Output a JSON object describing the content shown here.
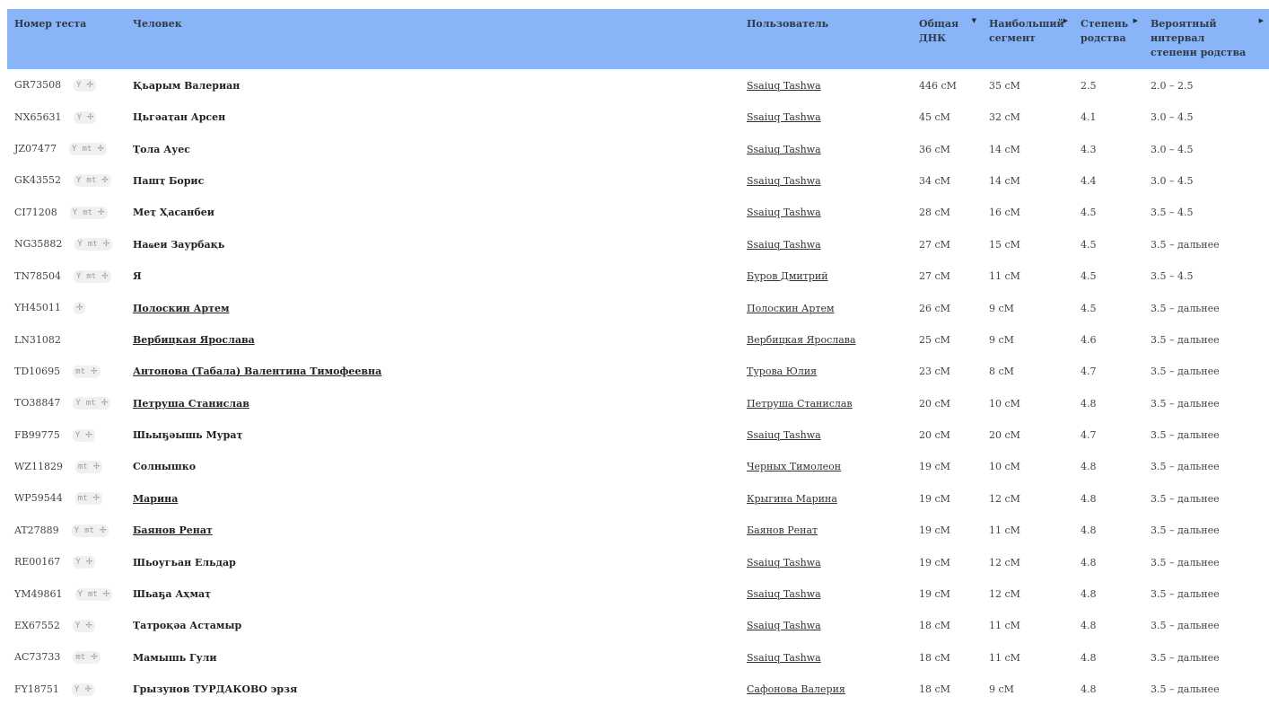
{
  "headers": {
    "test_number": "Номер теста",
    "person": "Человек",
    "user": "Пользователь",
    "total_dna_1": "Общая",
    "total_dna_2": "ДНК",
    "largest_1": "Наибольший",
    "largest_2": "сегмент",
    "degree_1": "Степень",
    "degree_2": "родства",
    "interval_1": "Вероятный интервал",
    "interval_2": "степени родства",
    "sort_down_icon": "▼",
    "sort_right_icon": "▶"
  },
  "rows": [
    {
      "id": "GR73508",
      "badges": [
        "Y",
        "🧬"
      ],
      "person": "Қьарым Валериан",
      "person_link": false,
      "user": "Ssaiuq Tashwa",
      "total": "446 cM",
      "largest": "35 cM",
      "degree": "2.5",
      "interval": "2.0 – 2.5"
    },
    {
      "id": "NX65631",
      "badges": [
        "Y",
        "🧬"
      ],
      "person": "Цьгәаҭан Арсен",
      "person_link": false,
      "user": "Ssaiuq Tashwa",
      "total": "45 cM",
      "largest": "32 cM",
      "degree": "4.1",
      "interval": "3.0 – 4.5"
    },
    {
      "id": "JZ07477",
      "badges": [
        "Y",
        "mt",
        "🧬"
      ],
      "person": "Ҭола Ауес",
      "person_link": false,
      "user": "Ssaiuq Tashwa",
      "total": "36 cM",
      "largest": "14 cM",
      "degree": "4.3",
      "interval": "3.0 – 4.5"
    },
    {
      "id": "GK43552",
      "badges": [
        "Y",
        "mt",
        "🧬"
      ],
      "person": "Пашҭ Борис",
      "person_link": false,
      "user": "Ssaiuq Tashwa",
      "total": "34 cM",
      "largest": "14 cM",
      "degree": "4.4",
      "interval": "3.0 – 4.5"
    },
    {
      "id": "CI71208",
      "badges": [
        "Y",
        "mt",
        "🧬"
      ],
      "person": "Меҭ Ҳасанбеи",
      "person_link": false,
      "user": "Ssaiuq Tashwa",
      "total": "28 cM",
      "largest": "16 cM",
      "degree": "4.5",
      "interval": "3.5 – 4.5"
    },
    {
      "id": "NG35882",
      "badges": [
        "Y",
        "mt",
        "🧬"
      ],
      "person": "Наҩеи Заурбақь",
      "person_link": false,
      "user": "Ssaiuq Tashwa",
      "total": "27 cM",
      "largest": "15 cM",
      "degree": "4.5",
      "interval": "3.5 – дальнее"
    },
    {
      "id": "TN78504",
      "badges": [
        "Y",
        "mt",
        "🧬"
      ],
      "person": "Я",
      "person_link": false,
      "user": "Буров Дмитрий",
      "total": "27 cM",
      "largest": "11 cM",
      "degree": "4.5",
      "interval": "3.5 – 4.5"
    },
    {
      "id": "YH45011",
      "badges": [
        "🧬"
      ],
      "person": "Полоскин Артем",
      "person_link": true,
      "user": "Полоскин Артем",
      "total": "26 cM",
      "largest": "9 cM",
      "degree": "4.5",
      "interval": "3.5 – дальнее"
    },
    {
      "id": "LN31082",
      "badges": [],
      "person": "Вербицкая Ярослава",
      "person_link": true,
      "user": "Вербицкая Ярослава",
      "total": "25 cM",
      "largest": "9 cM",
      "degree": "4.6",
      "interval": "3.5 – дальнее"
    },
    {
      "id": "TD10695",
      "badges": [
        "mt",
        "🧬"
      ],
      "person": "Антонова (Табала) Валентина Тимофеевна",
      "person_link": true,
      "user": "Турова Юлия",
      "total": "23 cM",
      "largest": "8 cM",
      "degree": "4.7",
      "interval": "3.5 – дальнее"
    },
    {
      "id": "TO38847",
      "badges": [
        "Y",
        "mt",
        "🧬"
      ],
      "person": "Петруша Станислав",
      "person_link": true,
      "user": "Петруша Станислав",
      "total": "20 cM",
      "largest": "10 cM",
      "degree": "4.8",
      "interval": "3.5 – дальнее"
    },
    {
      "id": "FB99775",
      "badges": [
        "Y",
        "🧬"
      ],
      "person": "Шьыҕәышь Мураҭ",
      "person_link": false,
      "user": "Ssaiuq Tashwa",
      "total": "20 cM",
      "largest": "20 cM",
      "degree": "4.7",
      "interval": "3.5 – дальнее"
    },
    {
      "id": "WZ11829",
      "badges": [
        "mt",
        "🧬"
      ],
      "person": "Солнышко",
      "person_link": false,
      "user": "Черных Тимолеон",
      "total": "19 cM",
      "largest": "10 cM",
      "degree": "4.8",
      "interval": "3.5 – дальнее"
    },
    {
      "id": "WP59544",
      "badges": [
        "mt",
        "🧬"
      ],
      "person": "Марина",
      "person_link": true,
      "user": "Крыгина Марина",
      "total": "19 cM",
      "largest": "12 cM",
      "degree": "4.8",
      "interval": "3.5 – дальнее"
    },
    {
      "id": "AT27889",
      "badges": [
        "Y",
        "mt",
        "🧬"
      ],
      "person": "Баянов Ренат",
      "person_link": true,
      "user": "Баянов Ренат",
      "total": "19 cM",
      "largest": "11 cM",
      "degree": "4.8",
      "interval": "3.5 – дальнее"
    },
    {
      "id": "RE00167",
      "badges": [
        "Y",
        "🧬"
      ],
      "person": "Шьоугьан Ельдар",
      "person_link": false,
      "user": "Ssaiuq Tashwa",
      "total": "19 cM",
      "largest": "12 cM",
      "degree": "4.8",
      "interval": "3.5 – дальнее"
    },
    {
      "id": "YM49861",
      "badges": [
        "Y",
        "mt",
        "🧬"
      ],
      "person": "Шьаҕа Аҳмаҭ",
      "person_link": false,
      "user": "Ssaiuq Tashwa",
      "total": "19 cM",
      "largest": "12 cM",
      "degree": "4.8",
      "interval": "3.5 – дальнее"
    },
    {
      "id": "EX67552",
      "badges": [
        "Y",
        "🧬"
      ],
      "person": "Ҭатроқәа Асҭамыр",
      "person_link": false,
      "user": "Ssaiuq Tashwa",
      "total": "18 cM",
      "largest": "11 cM",
      "degree": "4.8",
      "interval": "3.5 – дальнее"
    },
    {
      "id": "AC73733",
      "badges": [
        "mt",
        "🧬"
      ],
      "person": "Мамышь Гули",
      "person_link": false,
      "user": "Ssaiuq Tashwa",
      "total": "18 cM",
      "largest": "11 cM",
      "degree": "4.8",
      "interval": "3.5 – дальнее"
    },
    {
      "id": "FY18751",
      "badges": [
        "Y",
        "🧬"
      ],
      "person": "Грызунов ТУРДАКОВО эрзя",
      "person_link": false,
      "user": "Сафонова Валерия",
      "total": "18 cM",
      "largest": "9 cM",
      "degree": "4.8",
      "interval": "3.5 – дальнее"
    }
  ]
}
